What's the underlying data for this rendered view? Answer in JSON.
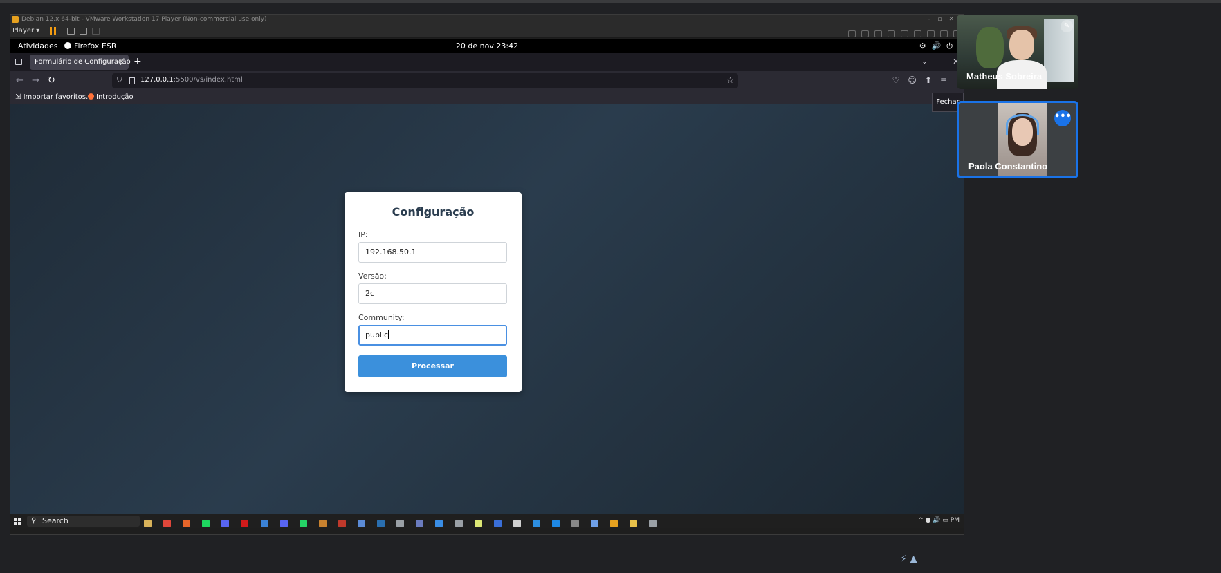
{
  "vm": {
    "title": "Debian 12.x 64-bit - VMware Workstation 17 Player (Non-commercial use only)",
    "player_label": "Player"
  },
  "gnome": {
    "activities": "Atividades",
    "app_name": "Firefox ESR",
    "clock": "20 de nov  23:42"
  },
  "browser": {
    "tab_title": "Formulário de Configuração",
    "url_host": "127.0.0.1",
    "url_rest": ":5500/vs/index.html",
    "tooltip": "Fechar",
    "bookmarks": [
      "Importar favoritos…",
      "Introdução"
    ]
  },
  "form": {
    "title": "Configuração",
    "ip_label": "IP:",
    "ip_value": "192.168.50.1",
    "version_label": "Versão:",
    "version_value": "2c",
    "community_label": "Community:",
    "community_value": "public",
    "submit_label": "Processar"
  },
  "taskbar": {
    "search_label": "Search",
    "tray_time": "PM"
  },
  "meeting": {
    "participants": [
      "Matheus Sobreira",
      "Paola Constantino"
    ]
  },
  "colors": {
    "accent": "#3b90dc",
    "focus_border": "#4a90e2",
    "meeting_highlight": "#1a73e8"
  }
}
